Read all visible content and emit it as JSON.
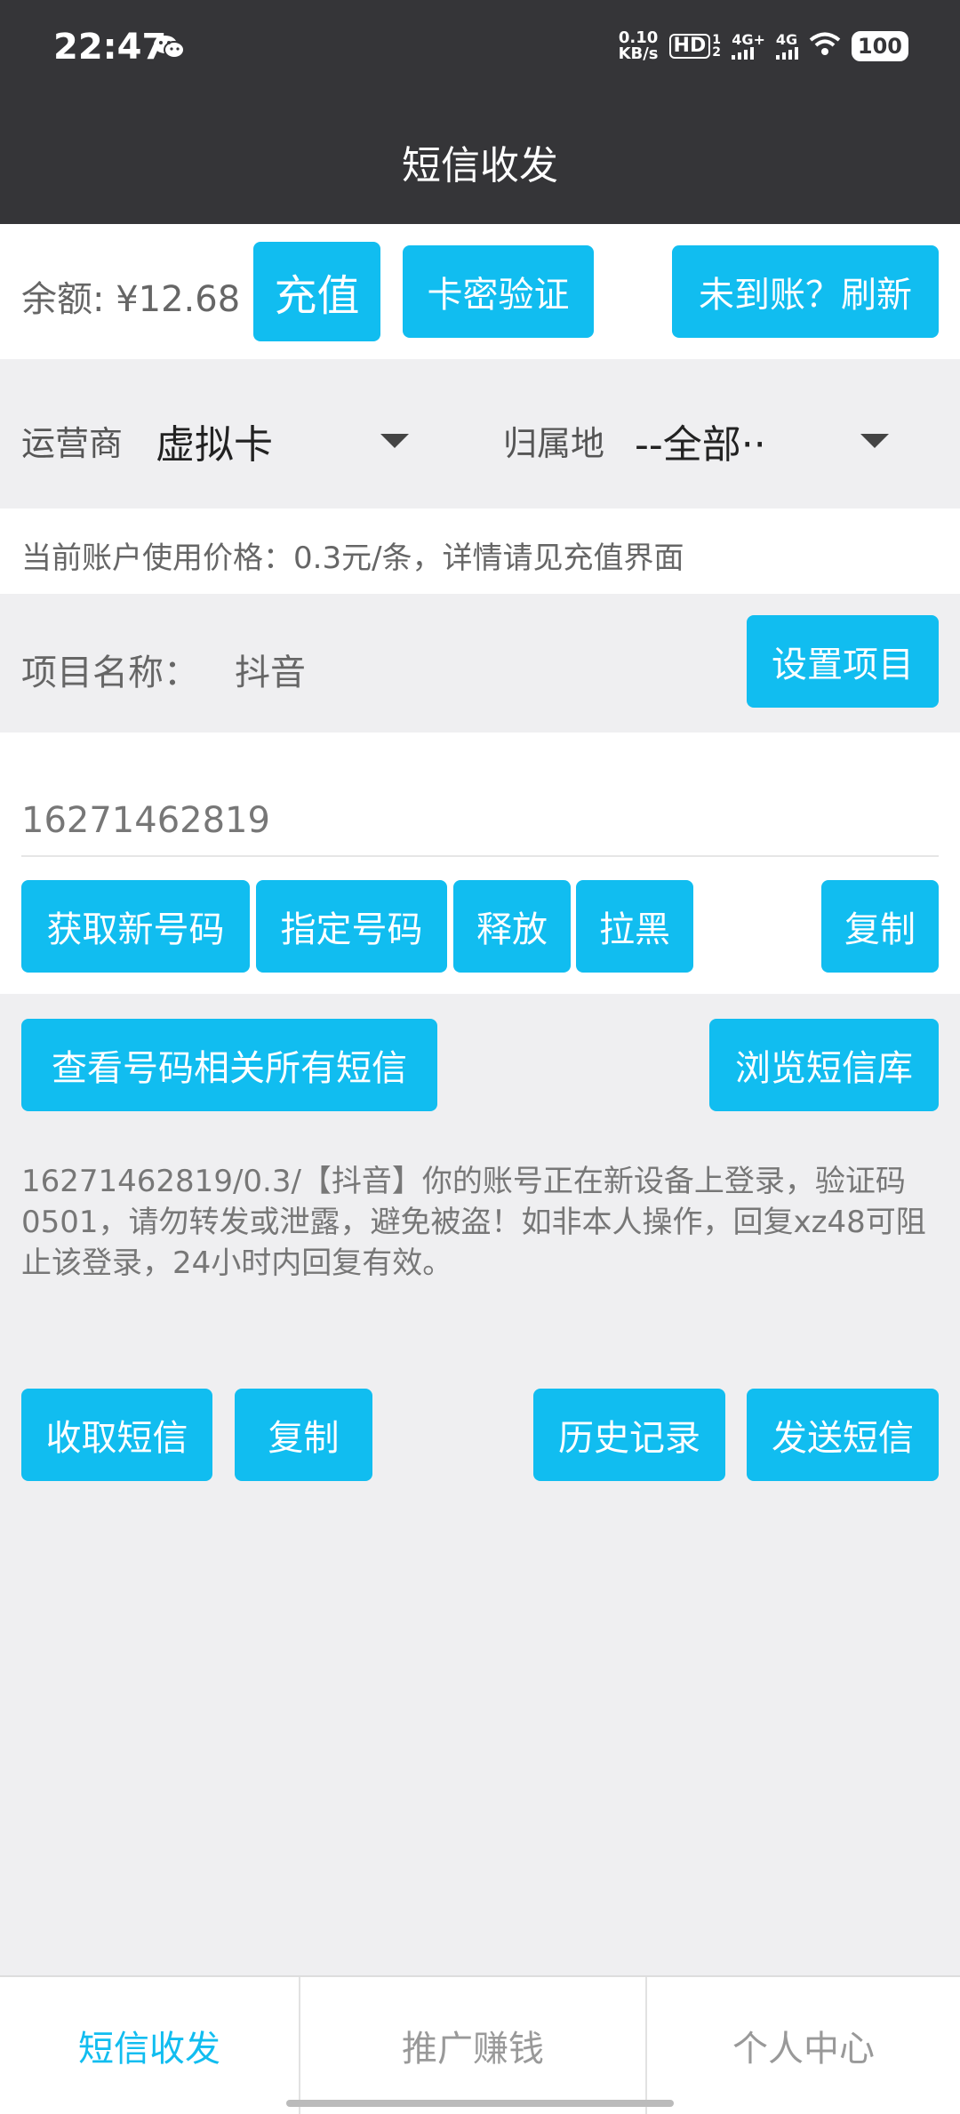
{
  "status": {
    "time": "22:47",
    "net_speed_top": "0.10",
    "net_speed_bottom": "KB/s",
    "hd": "HD",
    "hd_sub": "1 2",
    "sig1": "4G+",
    "sig2": "4G",
    "battery": "100"
  },
  "header": {
    "title": "短信收发"
  },
  "balance": {
    "text": "余额: ¥12.68",
    "recharge": "充值",
    "card_verify": "卡密验证",
    "refresh": "未到账？刷新"
  },
  "filter": {
    "operator_label": "运营商",
    "operator_value": "虚拟卡",
    "location_label": "归属地",
    "location_value": "--全部··"
  },
  "price_note": "当前账户使用价格：0.3元/条，详情请见充值界面",
  "project": {
    "label": "项目名称：",
    "value": "抖音",
    "set_button": "设置项目"
  },
  "number": {
    "value": "16271462819",
    "get_new": "获取新号码",
    "specify": "指定号码",
    "release": "释放",
    "blacklist": "拉黑",
    "copy": "复制"
  },
  "sms": {
    "view_all": "查看号码相关所有短信",
    "browse_lib": "浏览短信库",
    "message": "16271462819/0.3/【抖音】你的账号正在新设备上登录，验证码0501，请勿转发或泄露，避免被盗！如非本人操作，回复xz48可阻止该登录，24小时内回复有效。",
    "receive": "收取短信",
    "copy": "复制",
    "history": "历史记录",
    "send": "发送短信"
  },
  "nav": {
    "items": [
      "短信收发",
      "推广赚钱",
      "个人中心"
    ],
    "active_color": "#11bdf0"
  },
  "colors": {
    "accent": "#11bdf0",
    "header_bg": "#353538"
  }
}
